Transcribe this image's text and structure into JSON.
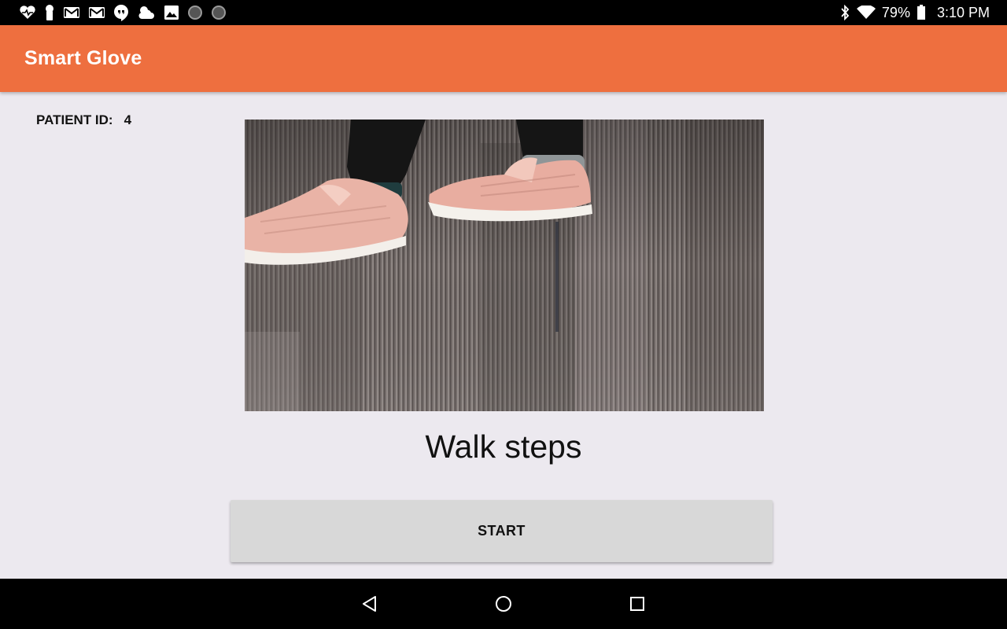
{
  "status_bar": {
    "battery": "79%",
    "time": "3:10 PM",
    "left_icons": [
      "heart-monitor-icon",
      "keyhole-icon",
      "gmail-icon",
      "gmail-icon",
      "hangouts-icon",
      "weather-icon",
      "gallery-icon",
      "circle-icon",
      "circle-icon"
    ],
    "right_icons": [
      "bluetooth-icon",
      "wifi-icon",
      "battery-icon"
    ]
  },
  "app_bar": {
    "title": "Smart Glove",
    "color": "#EE6F3F"
  },
  "patient": {
    "label": "PATIENT ID:",
    "value": "4"
  },
  "exercise": {
    "image": "walking-feet-photo",
    "title": "Walk steps"
  },
  "start_button": {
    "label": "START"
  },
  "nav_bar": {
    "buttons": [
      "back-icon",
      "home-icon",
      "recents-icon"
    ]
  }
}
